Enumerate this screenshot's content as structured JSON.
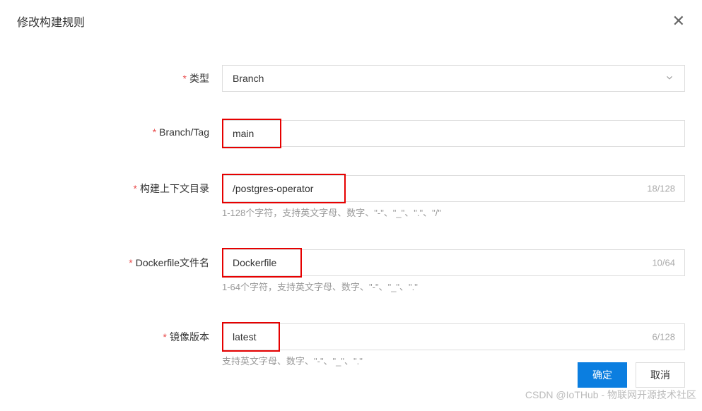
{
  "dialog": {
    "title": "修改构建规则"
  },
  "fields": {
    "type": {
      "label": "类型",
      "value": "Branch"
    },
    "branch_tag": {
      "label": "Branch/Tag",
      "value": "main"
    },
    "context_dir": {
      "label": "构建上下文目录",
      "value": "/postgres-operator",
      "counter": "18/128",
      "hint": "1-128个字符，支持英文字母、数字、\"-\"、\"_\"、\".\"、\"/\""
    },
    "dockerfile": {
      "label": "Dockerfile文件名",
      "value": "Dockerfile",
      "counter": "10/64",
      "hint": "1-64个字符，支持英文字母、数字、\"-\"、\"_\"、\".\""
    },
    "image_version": {
      "label": "镜像版本",
      "value": "latest",
      "counter": "6/128",
      "hint": "支持英文字母、数字、\"-\"、\"_\"、\".\""
    }
  },
  "buttons": {
    "confirm": "确定",
    "cancel": "取消"
  },
  "watermark": "CSDN @IoTHub - 物联网开源技术社区"
}
